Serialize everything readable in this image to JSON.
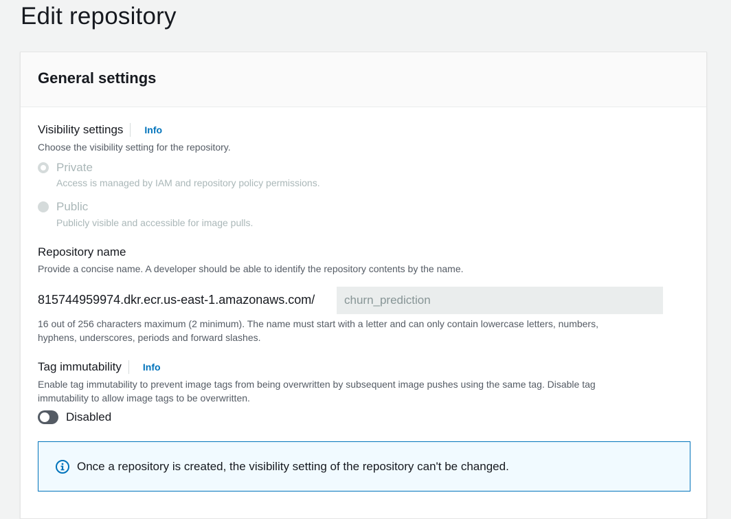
{
  "page": {
    "title": "Edit repository"
  },
  "general": {
    "title": "General settings",
    "visibility": {
      "label": "Visibility settings",
      "info": "Info",
      "description": "Choose the visibility setting for the repository.",
      "options": [
        {
          "label": "Private",
          "description": "Access is managed by IAM and repository policy permissions.",
          "checked": true
        },
        {
          "label": "Public",
          "description": "Publicly visible and accessible for image pulls.",
          "checked": false
        }
      ]
    },
    "repo_name": {
      "label": "Repository name",
      "description": "Provide a concise name. A developer should be able to identify the repository contents by the name.",
      "prefix": "815744959974.dkr.ecr.us-east-1.amazonaws.com/",
      "value": "churn_prediction",
      "constraint_line1": "16 out of 256 characters maximum (2 minimum). The name must start with a letter and can only contain lowercase letters, numbers,",
      "constraint_line2": "hyphens, underscores, periods and forward slashes."
    },
    "tag_immutability": {
      "label": "Tag immutability",
      "info": "Info",
      "description_line1": "Enable tag immutability to prevent image tags from being overwritten by subsequent image pushes using the same tag. Disable tag",
      "description_line2": "immutability to allow image tags to be overwritten.",
      "toggle_label": "Disabled",
      "enabled": false
    },
    "alert": {
      "text": "Once a repository is created, the visibility setting of the repository can't be changed.",
      "icon": "info-circle-icon"
    }
  },
  "colors": {
    "accent": "#0073bb",
    "alert_bg": "#f1faff",
    "disabled_text": "#aab7b8"
  }
}
